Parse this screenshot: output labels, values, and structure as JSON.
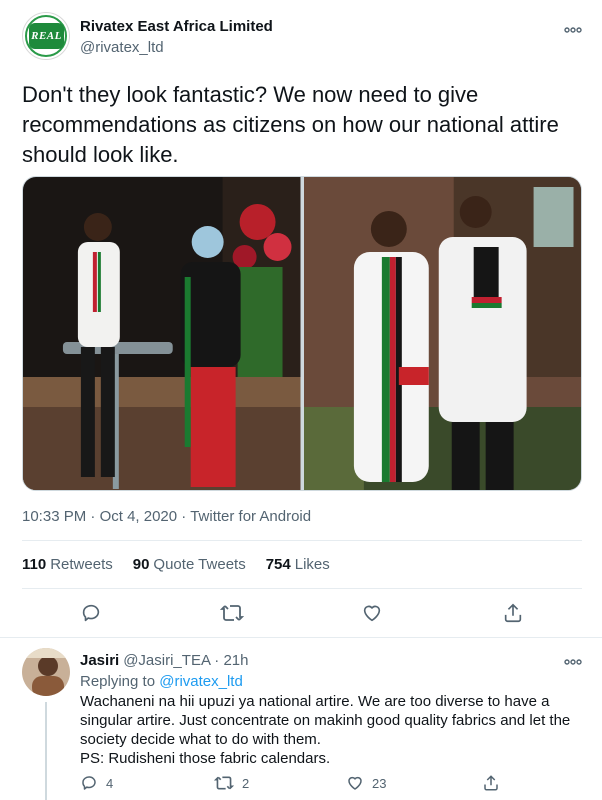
{
  "tweet": {
    "display_name": "Rivatex East Africa Limited",
    "handle": "@rivatex_ltd",
    "avatar_text": "REAL",
    "more_icon": "ellipsis-icon",
    "text": "Don't they look fantastic? We now need to give recommendations as citizens on how our national attire should look like.",
    "time": "10:33 PM",
    "date": "Oct 4, 2020",
    "client": "Twitter for Android",
    "separator": "·",
    "stats": {
      "retweets_count": "110",
      "retweets_label": "Retweets",
      "quotes_count": "90",
      "quotes_label": "Quote Tweets",
      "likes_count": "754",
      "likes_label": "Likes"
    },
    "actions": [
      "reply-icon",
      "retweet-icon",
      "like-icon",
      "share-icon"
    ]
  },
  "reply": {
    "display_name": "Jasiri",
    "handle": "@Jasiri_TEA",
    "time": "21h",
    "separator": "·",
    "replying_prefix": "Replying to",
    "replying_to": "@rivatex_ltd",
    "body_lines": [
      "Wachaneni na hii upuzi ya national artire. We are too diverse to have a",
      "singular artire. Just concentrate on makinh good quality fabrics and let the",
      "society decide what to do with them.",
      "PS: Rudisheni those fabric calendars."
    ],
    "counts": {
      "replies": "4",
      "retweets": "2",
      "likes": "23"
    }
  },
  "colors": {
    "text": "#0f1419",
    "secondary": "#536471",
    "link": "#1d9bf0",
    "border": "#cfd9de",
    "brand_green": "#1e8a3b"
  }
}
